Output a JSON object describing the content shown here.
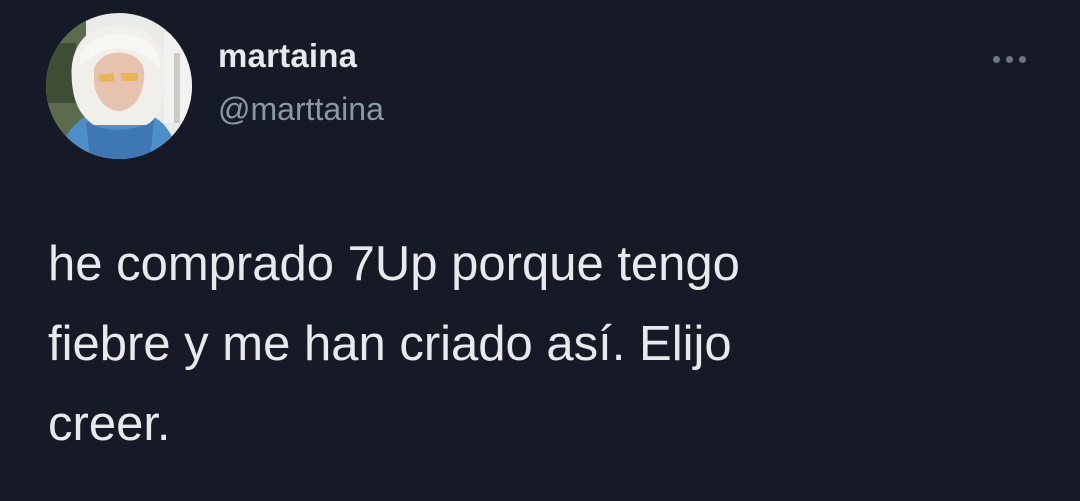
{
  "author": {
    "display_name": "martaina",
    "handle": "@marttaina",
    "avatar_icon": "profile-photo-icon"
  },
  "menu": {
    "icon": "more-options-icon"
  },
  "tweet": {
    "text_line_1": "he comprado 7Up porque tengo",
    "text_line_2": "fiebre y me han criado así. Elijo",
    "text_line_3": "creer."
  },
  "colors": {
    "background": "#151a26",
    "primary_text": "#e7e9ea",
    "secondary_text": "#8b98a5"
  }
}
